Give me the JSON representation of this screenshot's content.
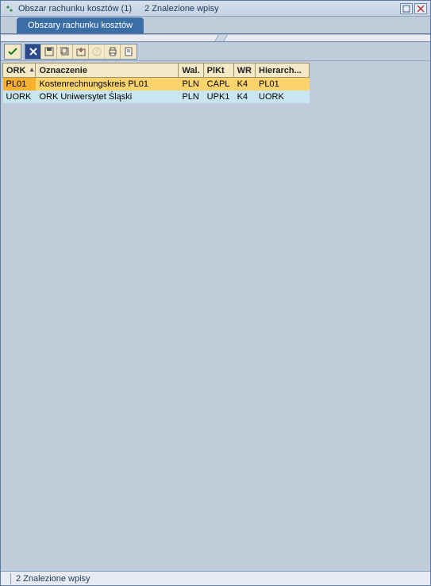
{
  "title": "Obszar rachunku kosztów (1)",
  "subtitle": "2 Znalezione wpisy",
  "tab_label": "Obszary rachunku kosztów",
  "columns": {
    "ork": "ORK",
    "oznaczenie": "Oznaczenie",
    "wal": "Wal.",
    "plkt": "PlKt",
    "wr": "WR",
    "hierarch": "Hierarch..."
  },
  "rows": [
    {
      "ork": "PL01",
      "oznaczenie": "Kostenrechnungskreis PL01",
      "wal": "PLN",
      "plkt": "CAPL",
      "wr": "K4",
      "hier": "PL01"
    },
    {
      "ork": "UORK",
      "oznaczenie": "ORK Uniwersytet Śląski",
      "wal": "PLN",
      "plkt": "UPK1",
      "wr": "K4",
      "hier": "UORK"
    }
  ],
  "status": "2 Znalezione wpisy"
}
